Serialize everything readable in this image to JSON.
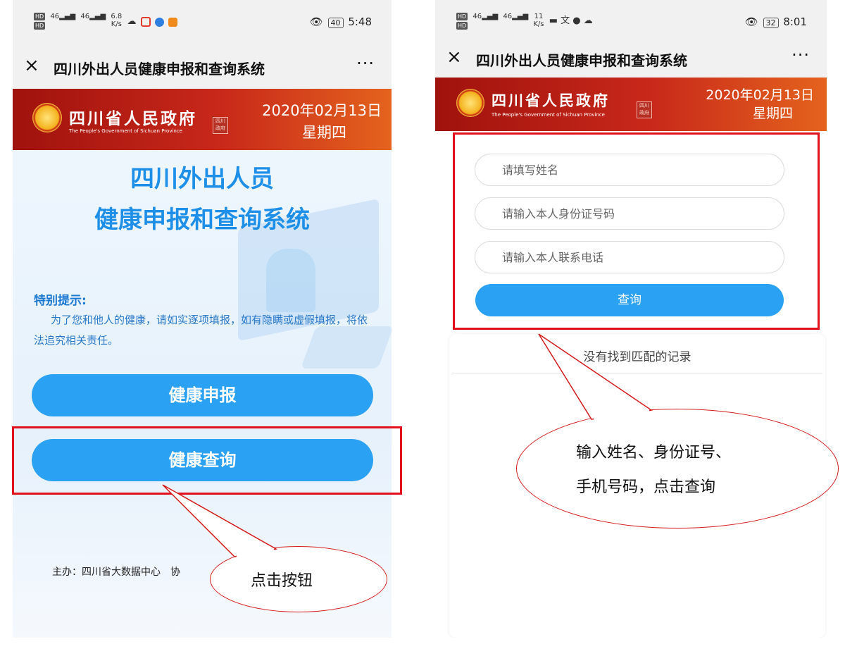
{
  "left_screen": {
    "status": {
      "hd_1": "HD",
      "hd_2": "HD",
      "sig1": "46",
      "sig2": "46",
      "speed": "6.8",
      "speed_unit": "K/s",
      "battery": "40",
      "time": "5:48"
    },
    "titlebar": {
      "close": "×",
      "title": "四川外出人员健康申报和查询系统",
      "more": "···"
    },
    "banner": {
      "gov_cn": "四川省人民政府",
      "gov_en": "The People's Government of Sichuan Province",
      "date": "2020年02月13日",
      "weekday": "星期四"
    },
    "hero_title_line1": "四川外出人员",
    "hero_title_line2": "健康申报和查询系统",
    "tip_heading": "特别提示:",
    "tip_body": "为了您和他人的健康，请如实逐项填报，如有隐瞒或虚假填报，将依法追究相关责任。",
    "btn_declare": "健康申报",
    "btn_query": "健康查询",
    "footer": "主办：四川省大数据中心　协",
    "callout": "点击按钮"
  },
  "right_screen": {
    "status": {
      "hd_1": "HD",
      "hd_2": "HD",
      "sig1": "46",
      "sig2": "46",
      "speed": "11",
      "speed_unit": "K/s",
      "battery": "32",
      "time": "8:01"
    },
    "titlebar": {
      "close": "×",
      "title": "四川外出人员健康申报和查询系统",
      "more": "···"
    },
    "banner": {
      "gov_cn": "四川省人民政府",
      "gov_en": "The People's Government of Sichuan Province",
      "date": "2020年02月13日",
      "weekday": "星期四"
    },
    "form": {
      "name_placeholder": "请填写姓名",
      "id_placeholder": "请输入本人身份证号码",
      "phone_placeholder": "请输入本人联系电话",
      "submit": "查询"
    },
    "no_record": "没有找到匹配的记录",
    "callout_line1": "输入姓名、身份证号、",
    "callout_line2": "手机号码，点击查询"
  },
  "colors": {
    "accent_blue": "#2aa1f3",
    "title_blue": "#1e8fe8",
    "banner_red": "#b51c12",
    "highlight_red": "#e1101d"
  }
}
